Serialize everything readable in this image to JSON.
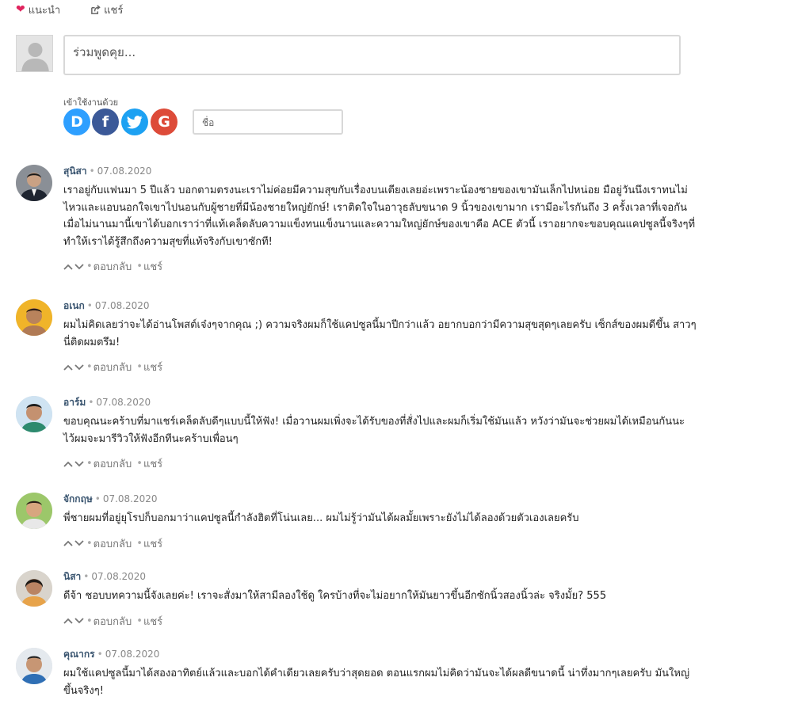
{
  "topbar": {
    "recommend_label": "แนะนำ",
    "share_label": "แชร์"
  },
  "composer": {
    "placeholder": "ร่วมพูดคุย..."
  },
  "login": {
    "label": "เข้าใช้งานด้วย",
    "providers": [
      {
        "letter": "D",
        "name": "disqus"
      },
      {
        "letter": "f",
        "name": "facebook"
      },
      {
        "letter": "t",
        "name": "twitter"
      },
      {
        "letter": "G",
        "name": "google"
      }
    ],
    "name_placeholder": "ชื่อ"
  },
  "actions": {
    "reply": "ตอบกลับ",
    "share": "แชร์"
  },
  "comments": [
    {
      "author": "สุนิสา",
      "date": "07.08.2020",
      "text": "เราอยู่กับแฟนมา 5 ปีแล้ว บอกตามตรงนะเราไม่ค่อยมีความสุขกับเรื่องบนเตียงเลยอ่ะเพราะน้องชายของเขามันเล็กไปหน่อย มือยู่วันนึงเราทนไม่ไหวและแอบนอกใจเขาไปนอนกับผู้ชายที่มีน้องชายใหญ่ยักษ์! เราติดใจในอาวุธลับขนาด 9 นิ้วของเขามาก เรามีอะไรกันถึง 3 ครั้งเวลาที่เจอกัน เมื่อไม่นานมานี้เขาได้บอกเราว่าที่แท้เคล็ดลับความแข็งทนแข็งนานและความใหญ่ยักษ์ของเขาคือ ACE ตัวนี้ เราอยากจะขอบคุณแคปซูลนี้จริงๆที่ทำให้เราได้รู้สึกถึงความสุขที่แท้จริงกับเขาซักที!"
    },
    {
      "author": "อเนก",
      "date": "07.08.2020",
      "text": "ผมไม่คิดเลยว่าจะได้อ่านโพสต์เจ๋งๆจากคุณ ;) ความจริงผมก็ใช้แคปซูลนี้มาปีกว่าแล้ว อยากบอกว่ามีความสุขสุดๆเลยครับ เซ็กส์ของผมดีขึ้น สาวๆนี่ติดผมตรึม!"
    },
    {
      "author": "อาร์ม",
      "date": "07.08.2020",
      "text": "ขอบคุณนะคร้าบที่มาแชร์เคล็ดลับดีๆแบบนี้ให้ฟัง! เมื่อวานผมเพิ่งจะได้รับของที่สั่งไปและผมก็เริ่มใช้มันแล้ว หวังว่ามันจะช่วยผมได้เหมือนกันนะ ไว้ผมจะมารีวิวให้ฟังอีกทีนะคร้าบเพื่อนๆ"
    },
    {
      "author": "จักกฤษ",
      "date": "07.08.2020",
      "text": "พี่ชายผมที่อยู่ยุโรปก็บอกมาว่าแคปซูลนี้กำลังฮิตที่โน่นเลย... ผมไม่รู้ว่ามันได้ผลมั้ยเพราะยังไม่ได้ลองด้วยตัวเองเลยครับ"
    },
    {
      "author": "นิสา",
      "date": "07.08.2020",
      "text": "ดีจ้า ชอบบทความนี้จังเลยค่ะ! เราจะสั่งมาให้สามีลองใช้ดู ใครบ้างที่จะไม่อยากให้มันยาวขึ้นอีกซักนิ้วสองนิ้วล่ะ จริงมั้ย? 555"
    },
    {
      "author": "คุณากร",
      "date": "07.08.2020",
      "text": "ผมใช้แคปซูลนี้มาได้สองอาทิตย์แล้วและบอกได้คำเดียวเลยครับว่าสุดยอด ตอนแรกผมไม่คิดว่ามันจะได้ผลดีขนาดนี้ น่าทึ่งมากๆเลยครับ มันใหญ่ขึ้นจริงๆ!"
    }
  ]
}
